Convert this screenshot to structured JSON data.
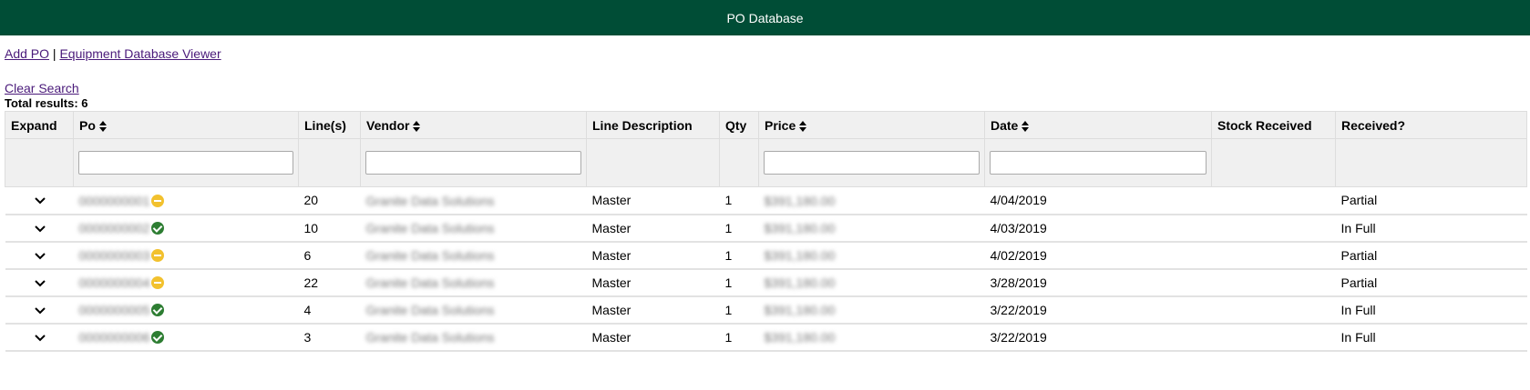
{
  "header": {
    "title": "PO Database"
  },
  "nav": {
    "add_po": "Add PO",
    "separator": "|",
    "equipment_viewer": "Equipment Database Viewer"
  },
  "search": {
    "clear_label": "Clear Search",
    "total_results": "Total results: 6"
  },
  "table": {
    "columns": {
      "expand": "Expand",
      "po": "Po",
      "lines": "Line(s)",
      "vendor": "Vendor",
      "line_description": "Line Description",
      "qty": "Qty",
      "price": "Price",
      "date": "Date",
      "stock_received": "Stock Received",
      "received": "Received?"
    },
    "rows": [
      {
        "po": "0000000001",
        "status": "partial",
        "lines": "20",
        "vendor": "Granite Data Solutions",
        "line_description": "Master",
        "qty": "1",
        "price": "$391,180.00",
        "date": "4/04/2019",
        "stock_received": "",
        "received": "Partial"
      },
      {
        "po": "0000000002",
        "status": "full",
        "lines": "10",
        "vendor": "Granite Data Solutions",
        "line_description": "Master",
        "qty": "1",
        "price": "$391,180.00",
        "date": "4/03/2019",
        "stock_received": "",
        "received": "In Full"
      },
      {
        "po": "0000000003",
        "status": "partial",
        "lines": "6",
        "vendor": "Granite Data Solutions",
        "line_description": "Master",
        "qty": "1",
        "price": "$391,180.00",
        "date": "4/02/2019",
        "stock_received": "",
        "received": "Partial"
      },
      {
        "po": "0000000004",
        "status": "partial",
        "lines": "22",
        "vendor": "Granite Data Solutions",
        "line_description": "Master",
        "qty": "1",
        "price": "$391,180.00",
        "date": "3/28/2019",
        "stock_received": "",
        "received": "Partial"
      },
      {
        "po": "0000000005",
        "status": "full",
        "lines": "4",
        "vendor": "Granite Data Solutions",
        "line_description": "Master",
        "qty": "1",
        "price": "$391,180.00",
        "date": "3/22/2019",
        "stock_received": "",
        "received": "In Full"
      },
      {
        "po": "0000000006",
        "status": "full",
        "lines": "3",
        "vendor": "Granite Data Solutions",
        "line_description": "Master",
        "qty": "1",
        "price": "$391,180.00",
        "date": "3/22/2019",
        "stock_received": "",
        "received": "In Full"
      }
    ]
  },
  "icons": {
    "expand": "chevron-down-icon",
    "sort": "sort-icon",
    "partial": "partial-status-icon",
    "full": "check-circle-icon"
  },
  "colors": {
    "header_bg": "#004d36",
    "partial": "#f2c12e",
    "full": "#2d7d32",
    "link": "#4a1a7a"
  }
}
